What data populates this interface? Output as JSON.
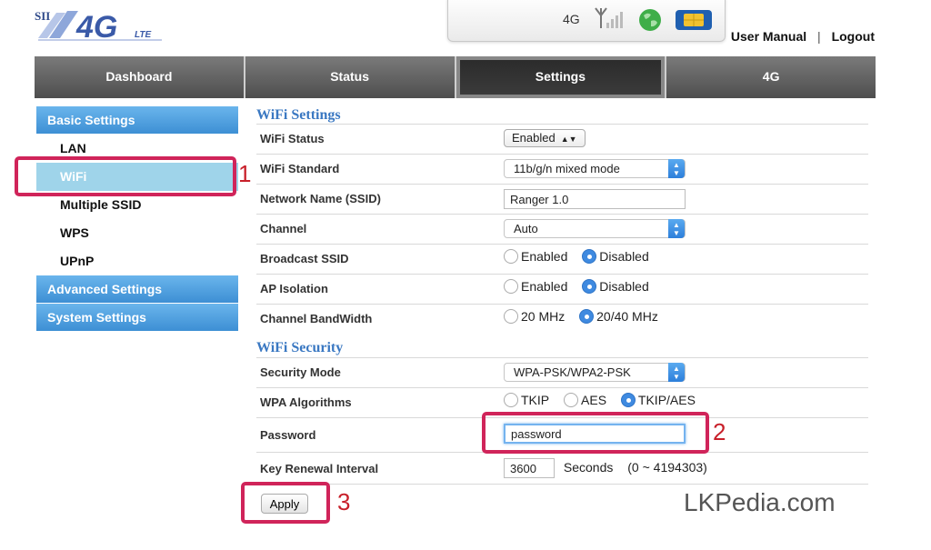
{
  "header": {
    "logo_text": "SII 4G LTE",
    "status_label": "4G",
    "user_manual": "User Manual",
    "separator": "|",
    "logout": "Logout"
  },
  "nav": {
    "tabs": [
      {
        "label": "Dashboard"
      },
      {
        "label": "Status"
      },
      {
        "label": "Settings"
      },
      {
        "label": "4G"
      }
    ],
    "active": "Settings"
  },
  "sidebar": {
    "groups": [
      {
        "label": "Basic Settings"
      },
      {
        "label": "Advanced Settings"
      },
      {
        "label": "System Settings"
      }
    ],
    "items": [
      {
        "label": "LAN"
      },
      {
        "label": "WiFi"
      },
      {
        "label": "Multiple SSID"
      },
      {
        "label": "WPS"
      },
      {
        "label": "UPnP"
      }
    ],
    "active_item": "WiFi"
  },
  "wifi_settings": {
    "title": "WiFi Settings",
    "status": {
      "label": "WiFi Status",
      "value": "Enabled"
    },
    "standard": {
      "label": "WiFi Standard",
      "value": "11b/g/n mixed mode"
    },
    "ssid": {
      "label": "Network Name (SSID)",
      "value": "Ranger 1.0"
    },
    "channel": {
      "label": "Channel",
      "value": "Auto"
    },
    "broadcast": {
      "label": "Broadcast SSID",
      "options": [
        "Enabled",
        "Disabled"
      ],
      "selected": "Disabled"
    },
    "ap_isolation": {
      "label": "AP Isolation",
      "options": [
        "Enabled",
        "Disabled"
      ],
      "selected": "Disabled"
    },
    "bandwidth": {
      "label": "Channel BandWidth",
      "options": [
        "20 MHz",
        "20/40 MHz"
      ],
      "selected": "20/40 MHz"
    }
  },
  "wifi_security": {
    "title": "WiFi Security",
    "mode": {
      "label": "Security Mode",
      "value": "WPA-PSK/WPA2-PSK"
    },
    "algorithms": {
      "label": "WPA Algorithms",
      "options": [
        "TKIP",
        "AES",
        "TKIP/AES"
      ],
      "selected": "TKIP/AES"
    },
    "password": {
      "label": "Password",
      "value": "password"
    },
    "key_renewal": {
      "label": "Key Renewal Interval",
      "value": "3600",
      "unit": "Seconds",
      "range": "(0 ~ 4194303)"
    }
  },
  "apply_label": "Apply",
  "annotations": {
    "one": "1",
    "two": "2",
    "three": "3"
  },
  "watermark": "LKPedia.com",
  "colors": {
    "accent_blue": "#3d8fd4",
    "callout_red": "#d0245a",
    "active_sidebar": "#9fd4ea",
    "section_title": "#3a78c2"
  }
}
